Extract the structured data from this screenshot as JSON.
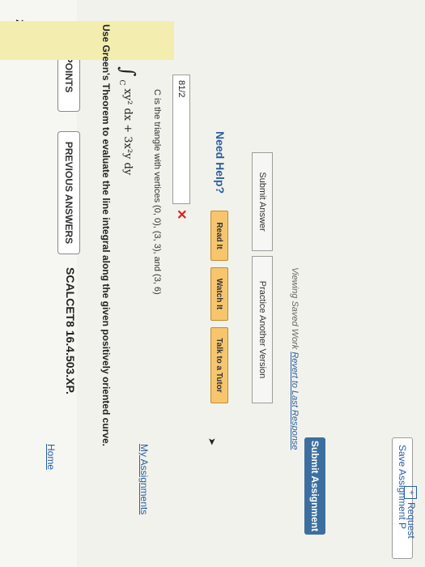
{
  "question": {
    "number": "2.",
    "points": "0/3 POINTS",
    "previous_answers": "PREVIOUS ANSWERS",
    "problem_id": "SCALCET8 16.4.503.XP."
  },
  "problem": {
    "instruction": "Use Green's Theorem to evaluate the line integral along the given positively oriented curve.",
    "integral_sign": "∫",
    "integral_sub": "C",
    "integrand": "xy² dx + 3x²y dy",
    "condition": "C is the triangle with vertices (0, 0), (3, 3), and (3, 6)"
  },
  "answer": {
    "value": "81/2",
    "status_mark": "✕"
  },
  "help": {
    "label": "Need Help?",
    "read_it": "Read It",
    "watch_it": "Watch It",
    "talk_tutor": "Talk to a Tutor"
  },
  "actions": {
    "submit_answer": "Submit Answer",
    "practice_another": "Practice Another Version",
    "viewing_saved": "Viewing Saved Work",
    "revert_link": "Revert to Last Response"
  },
  "assignment": {
    "submit": "Submit Assignment",
    "save": "Save Assignment P"
  },
  "footer": {
    "home": "Home",
    "my_assignments": "My Assignments",
    "request": "Request"
  },
  "icons": {
    "cursor": "cursor-arrow-icon",
    "request": "plus-box-icon"
  },
  "colors": {
    "accent": "#2b5fa0",
    "help_button": "#f6c56e",
    "submit_assignment": "#3c6f9f",
    "wrong": "#d22222",
    "answer_highlight": "#f3eeb0"
  }
}
